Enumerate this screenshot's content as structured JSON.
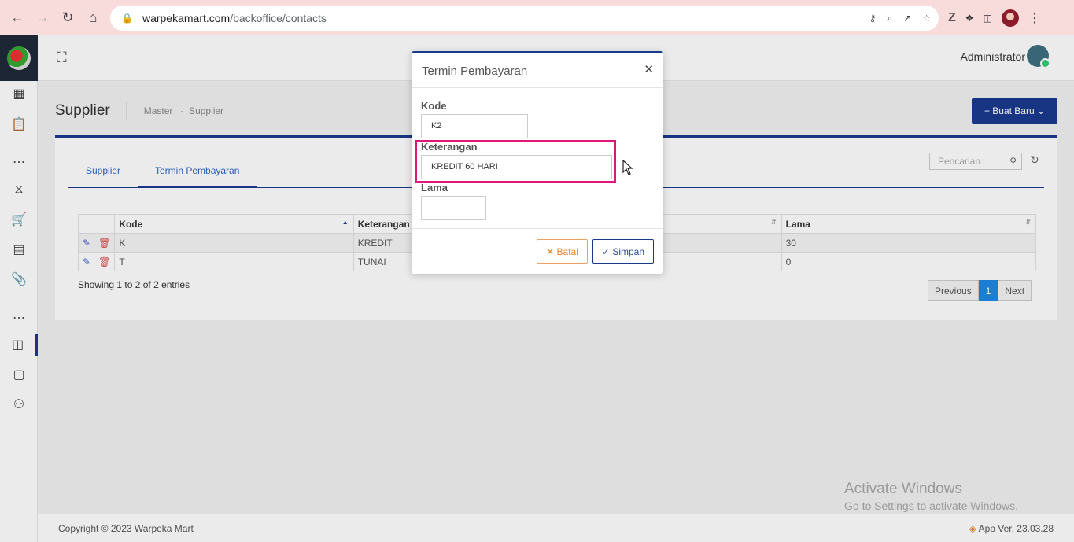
{
  "browser": {
    "url_domain": "warpekamart.com",
    "url_path": "/backoffice/contacts"
  },
  "topbar": {
    "user_name": "Administrator"
  },
  "page": {
    "title": "Supplier",
    "breadcrumb": "Master   -  Supplier",
    "new_button": "+ Buat Baru ⌄"
  },
  "tabs": [
    {
      "label": "Supplier"
    },
    {
      "label": "Termin Pembayaran"
    }
  ],
  "search": {
    "placeholder": "Pencarian"
  },
  "table": {
    "columns": [
      "Kode",
      "Keterangan",
      "Lama"
    ],
    "rows": [
      {
        "kode": "K",
        "keterangan": "KREDIT",
        "lama": "30"
      },
      {
        "kode": "T",
        "keterangan": "TUNAI",
        "lama": "0"
      }
    ]
  },
  "table_info": "Showing 1 to 2 of 2 entries",
  "pagination": {
    "previous": "Previous",
    "current": "1",
    "next": "Next"
  },
  "footer": {
    "copyright": "Copyright © 2023 Warpeka Mart",
    "version": "App Ver. 23.03.28"
  },
  "watermark": {
    "line1": "Activate Windows",
    "line2": "Go to Settings to activate Windows."
  },
  "modal": {
    "title": "Termin Pembayaran",
    "kode_label": "Kode",
    "kode_value": "K2",
    "keterangan_label": "Keterangan",
    "keterangan_value": "KREDIT 60 HARI",
    "lama_label": "Lama",
    "lama_value": "",
    "cancel_label": "✕ Batal",
    "save_label": "✓ Simpan"
  },
  "colors": {
    "primary": "#1a3a8f",
    "highlight": "#e0177a",
    "cancel": "#e8852a"
  }
}
